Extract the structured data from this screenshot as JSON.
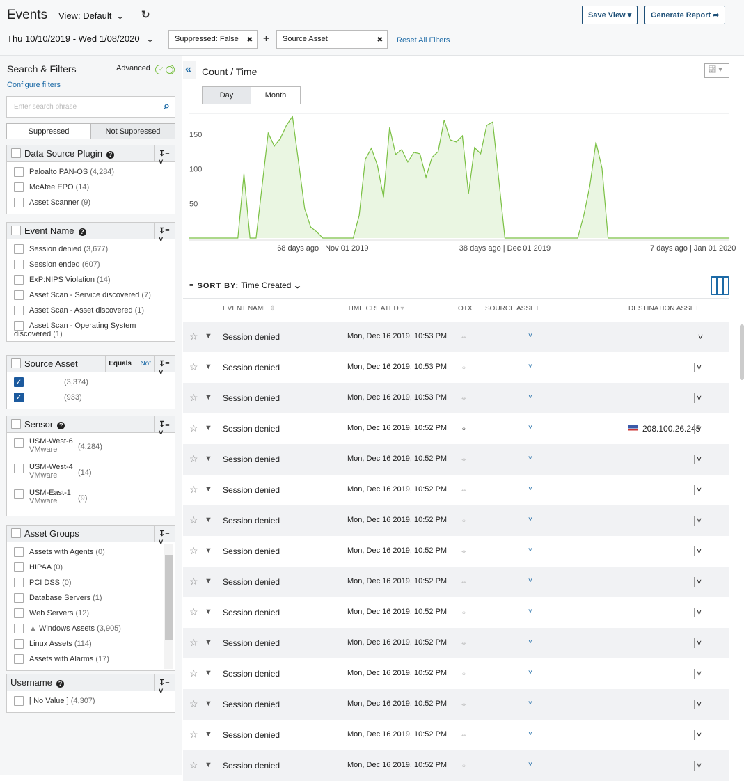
{
  "header": {
    "title": "Events",
    "view_label": "View:",
    "view_value": "Default",
    "save_view": "Save View",
    "generate_report": "Generate Report"
  },
  "filters": {
    "date_range": "Thu 10/10/2019 - Wed 1/08/2020",
    "chips": [
      {
        "label": "Suppressed:  False"
      },
      {
        "label": "Source Asset"
      }
    ],
    "reset": "Reset All Filters"
  },
  "sidebar": {
    "title": "Search & Filters",
    "advanced_label": "Advanced",
    "advanced_on": true,
    "configure": "Configure filters",
    "search_placeholder": "Enter search phrase",
    "suppression": [
      "Suppressed",
      "Not Suppressed"
    ],
    "suppression_selected": "Not Suppressed",
    "groups": [
      {
        "title": "Data Source Plugin",
        "help": true,
        "items": [
          {
            "label": "Paloalto PAN-OS",
            "count": "(4,284)"
          },
          {
            "label": "McAfee EPO",
            "count": "(14)"
          },
          {
            "label": "Asset Scanner",
            "count": "(9)"
          }
        ]
      },
      {
        "title": "Event Name",
        "help": true,
        "items": [
          {
            "label": "Session denied",
            "count": "(3,677)"
          },
          {
            "label": "Session ended",
            "count": "(607)"
          },
          {
            "label": "ExP:NIPS Violation",
            "count": "(14)"
          },
          {
            "label": "Asset Scan - Service discovered",
            "count": "(7)"
          },
          {
            "label": "Asset Scan - Asset discovered",
            "count": "(1)"
          },
          {
            "label": "Asset Scan - Operating System discovered",
            "count": "(1)"
          }
        ]
      },
      {
        "title": "Source Asset",
        "help": false,
        "equals": "Equals",
        "not": "Not",
        "items": [
          {
            "label": "",
            "count": "(3,374)",
            "checked": true
          },
          {
            "label": "",
            "count": "(933)",
            "checked": true
          }
        ]
      },
      {
        "title": "Sensor",
        "help": true,
        "items": [
          {
            "label": "USM-West-6",
            "sub": "VMware",
            "count": "(4,284)"
          },
          {
            "label": "USM-West-4",
            "sub": "VMware",
            "count": "(14)"
          },
          {
            "label": "USM-East-1",
            "sub": "VMware",
            "count": "(9)"
          }
        ]
      },
      {
        "title": "Asset Groups",
        "help": false,
        "scroll": true,
        "items": [
          {
            "label": "Assets with Agents",
            "count": "(0)"
          },
          {
            "label": "HIPAA",
            "count": "(0)"
          },
          {
            "label": "PCI DSS",
            "count": "(0)"
          },
          {
            "label": "Database Servers",
            "count": "(1)"
          },
          {
            "label": "Web Servers",
            "count": "(12)"
          },
          {
            "label": "Windows Assets",
            "count": "(3,905)",
            "warning": true
          },
          {
            "label": "Linux Assets",
            "count": "(114)"
          },
          {
            "label": "Assets with Alarms",
            "count": "(17)"
          }
        ]
      },
      {
        "title": "Username",
        "help": true,
        "nocheck": true,
        "items": [
          {
            "label": "[ No Value ]",
            "count": "(4,307)"
          }
        ]
      }
    ]
  },
  "chart_panel": {
    "title": "Count / Time",
    "granularity": [
      "Day",
      "Month"
    ],
    "selected": "Day"
  },
  "chart_data": {
    "type": "area",
    "title": "Count / Time",
    "color": "#7ac043",
    "fill": "#eaf6e2",
    "yticks": [
      50,
      100,
      150
    ],
    "ylim": [
      0,
      180
    ],
    "xtick_labels": [
      {
        "date": "2019-11-01",
        "label": "68 days ago | Nov 01 2019"
      },
      {
        "date": "2019-12-01",
        "label": "38 days ago | Dec 01 2019"
      },
      {
        "date": "2020-01-01",
        "label": "7 days ago | Jan 01 2020"
      }
    ],
    "x": [
      "2019-10-10",
      "2019-10-11",
      "2019-10-12",
      "2019-10-13",
      "2019-10-14",
      "2019-10-15",
      "2019-10-16",
      "2019-10-17",
      "2019-10-18",
      "2019-10-19",
      "2019-10-20",
      "2019-10-21",
      "2019-10-22",
      "2019-10-23",
      "2019-10-24",
      "2019-10-25",
      "2019-10-26",
      "2019-10-27",
      "2019-10-28",
      "2019-10-29",
      "2019-10-30",
      "2019-10-31",
      "2019-11-01",
      "2019-11-02",
      "2019-11-03",
      "2019-11-04",
      "2019-11-05",
      "2019-11-06",
      "2019-11-07",
      "2019-11-08",
      "2019-11-09",
      "2019-11-10",
      "2019-11-11",
      "2019-11-12",
      "2019-11-13",
      "2019-11-14",
      "2019-11-15",
      "2019-11-16",
      "2019-11-17",
      "2019-11-18",
      "2019-11-19",
      "2019-11-20",
      "2019-11-21",
      "2019-11-22",
      "2019-11-23",
      "2019-11-24",
      "2019-11-25",
      "2019-11-26",
      "2019-11-27",
      "2019-11-28",
      "2019-11-29",
      "2019-11-30",
      "2019-12-01",
      "2019-12-02",
      "2019-12-03",
      "2019-12-04",
      "2019-12-05",
      "2019-12-06",
      "2019-12-07",
      "2019-12-08",
      "2019-12-09",
      "2019-12-10",
      "2019-12-11",
      "2019-12-12",
      "2019-12-13",
      "2019-12-14",
      "2019-12-15",
      "2019-12-16",
      "2019-12-17",
      "2019-12-18",
      "2019-12-19",
      "2019-12-20",
      "2019-12-21",
      "2019-12-22",
      "2019-12-23",
      "2019-12-24",
      "2019-12-25",
      "2019-12-26",
      "2019-12-27",
      "2019-12-28",
      "2019-12-29",
      "2019-12-30",
      "2019-12-31",
      "2020-01-01",
      "2020-01-02",
      "2020-01-03",
      "2020-01-04",
      "2020-01-05",
      "2020-01-06",
      "2020-01-07"
    ],
    "values": [
      0,
      0,
      0,
      0,
      0,
      0,
      0,
      0,
      0,
      93,
      0,
      0,
      76,
      152,
      133,
      144,
      163,
      176,
      110,
      43,
      16,
      9,
      0,
      0,
      0,
      0,
      0,
      0,
      33,
      114,
      130,
      105,
      59,
      160,
      121,
      128,
      110,
      124,
      122,
      88,
      117,
      125,
      171,
      142,
      139,
      148,
      64,
      131,
      122,
      163,
      168,
      84,
      0,
      0,
      0,
      0,
      0,
      0,
      0,
      0,
      0,
      0,
      0,
      0,
      0,
      33,
      76,
      139,
      101,
      0,
      0,
      0,
      0,
      0,
      0,
      0,
      0,
      0,
      0,
      0,
      0,
      0,
      0,
      0,
      0,
      0,
      0,
      0,
      0,
      0
    ]
  },
  "table": {
    "sort_label": "SORT BY:",
    "sort_value": "Time Created",
    "columns": [
      "EVENT NAME",
      "TIME CREATED",
      "OTX",
      "SOURCE ASSET",
      "DESTINATION ASSET"
    ],
    "rows": [
      {
        "event": "Session denied",
        "time": "Mon, Dec 16 2019, 10:53 PM",
        "dest": ""
      },
      {
        "event": "Session denied",
        "time": "Mon, Dec 16 2019, 10:53 PM",
        "dest": ""
      },
      {
        "event": "Session denied",
        "time": "Mon, Dec 16 2019, 10:53 PM",
        "dest": ""
      },
      {
        "event": "Session denied",
        "time": "Mon, Dec 16 2019, 10:52 PM",
        "dest": "208.100.26.245",
        "flag": "us",
        "otx_active": true
      },
      {
        "event": "Session denied",
        "time": "Mon, Dec 16 2019, 10:52 PM",
        "dest": ""
      },
      {
        "event": "Session denied",
        "time": "Mon, Dec 16 2019, 10:52 PM",
        "dest": ""
      },
      {
        "event": "Session denied",
        "time": "Mon, Dec 16 2019, 10:52 PM",
        "dest": ""
      },
      {
        "event": "Session denied",
        "time": "Mon, Dec 16 2019, 10:52 PM",
        "dest": ""
      },
      {
        "event": "Session denied",
        "time": "Mon, Dec 16 2019, 10:52 PM",
        "dest": ""
      },
      {
        "event": "Session denied",
        "time": "Mon, Dec 16 2019, 10:52 PM",
        "dest": ""
      },
      {
        "event": "Session denied",
        "time": "Mon, Dec 16 2019, 10:52 PM",
        "dest": ""
      },
      {
        "event": "Session denied",
        "time": "Mon, Dec 16 2019, 10:52 PM",
        "dest": ""
      },
      {
        "event": "Session denied",
        "time": "Mon, Dec 16 2019, 10:52 PM",
        "dest": ""
      },
      {
        "event": "Session denied",
        "time": "Mon, Dec 16 2019, 10:52 PM",
        "dest": ""
      },
      {
        "event": "Session denied",
        "time": "Mon, Dec 16 2019, 10:52 PM",
        "dest": ""
      }
    ]
  }
}
